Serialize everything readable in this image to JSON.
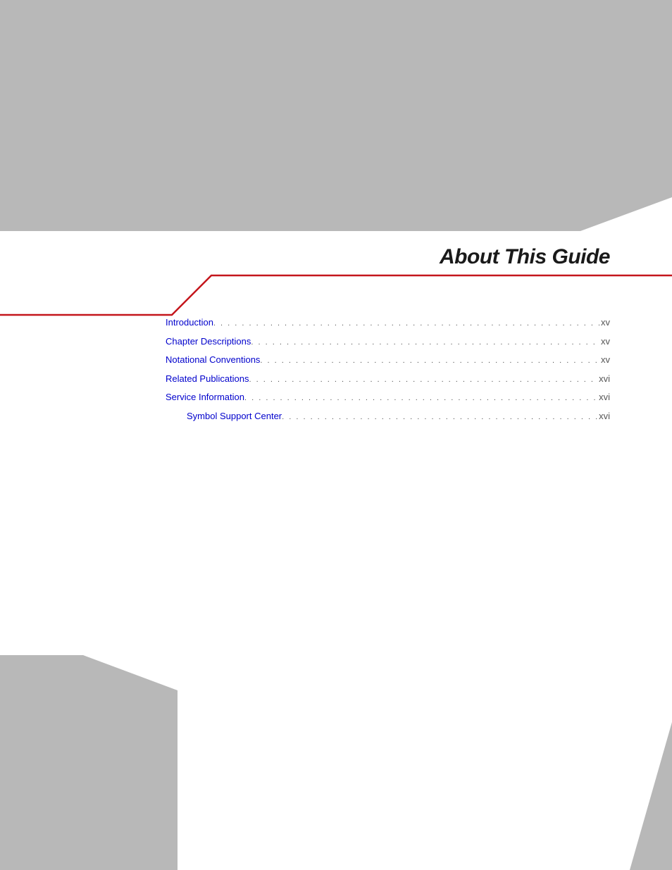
{
  "title": "About This Guide",
  "toc": [
    {
      "label": "Introduction",
      "page": "xv",
      "indent": 0
    },
    {
      "label": "Chapter Descriptions",
      "page": "xv",
      "indent": 0
    },
    {
      "label": "Notational Conventions",
      "page": "xv",
      "indent": 0
    },
    {
      "label": "Related Publications",
      "page": "xvi",
      "indent": 0
    },
    {
      "label": "Service Information",
      "page": "xvi",
      "indent": 0
    },
    {
      "label": "Symbol Support Center",
      "page": "xvi",
      "indent": 1
    }
  ],
  "colors": {
    "background_grey": "#b8b8b8",
    "red_accent": "#c4161c",
    "link_blue": "#0000cc"
  }
}
